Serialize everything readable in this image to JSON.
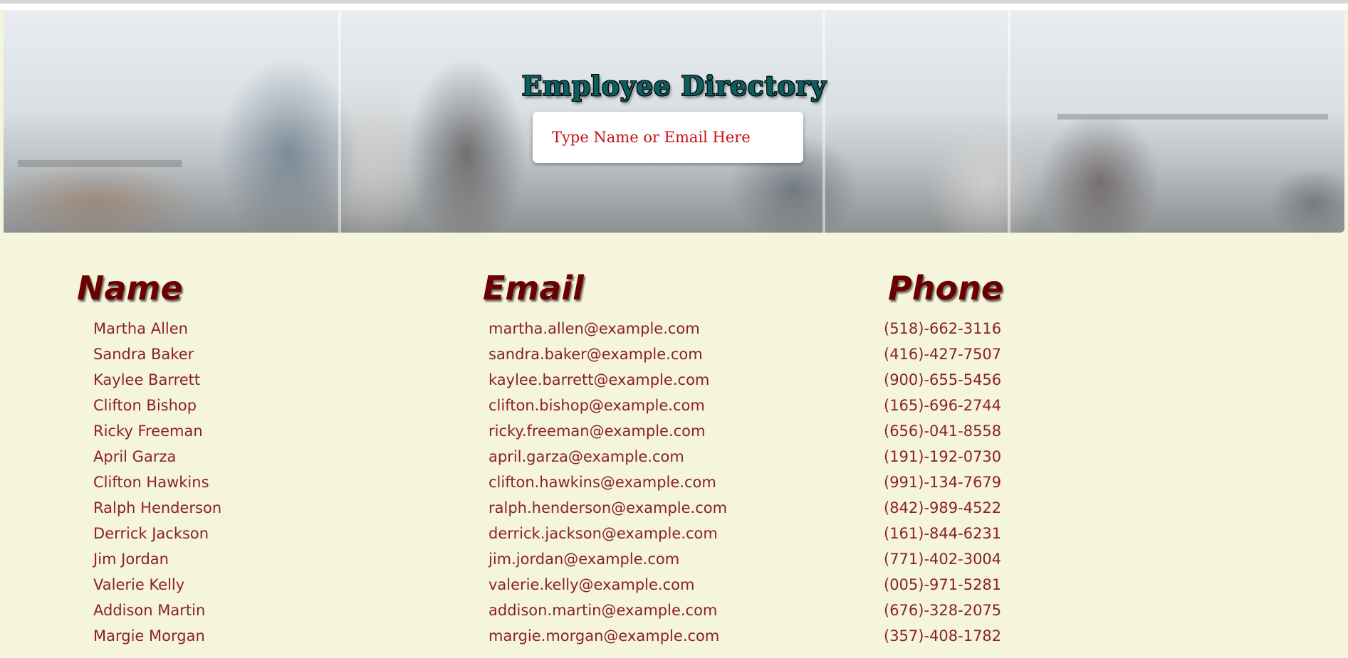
{
  "header": {
    "title": "Employee Directory",
    "search_placeholder": "Type Name or Email Here",
    "search_value": ""
  },
  "table": {
    "columns": [
      "Name",
      "Email",
      "Phone"
    ],
    "rows": [
      {
        "name": "Martha Allen",
        "email": "martha.allen@example.com",
        "phone": "(518)-662-3116"
      },
      {
        "name": "Sandra Baker",
        "email": "sandra.baker@example.com",
        "phone": "(416)-427-7507"
      },
      {
        "name": "Kaylee Barrett",
        "email": "kaylee.barrett@example.com",
        "phone": "(900)-655-5456"
      },
      {
        "name": "Clifton Bishop",
        "email": "clifton.bishop@example.com",
        "phone": "(165)-696-2744"
      },
      {
        "name": "Ricky Freeman",
        "email": "ricky.freeman@example.com",
        "phone": "(656)-041-8558"
      },
      {
        "name": "April Garza",
        "email": "april.garza@example.com",
        "phone": "(191)-192-0730"
      },
      {
        "name": "Clifton Hawkins",
        "email": "clifton.hawkins@example.com",
        "phone": "(991)-134-7679"
      },
      {
        "name": "Ralph Henderson",
        "email": "ralph.henderson@example.com",
        "phone": "(842)-989-4522"
      },
      {
        "name": "Derrick Jackson",
        "email": "derrick.jackson@example.com",
        "phone": "(161)-844-6231"
      },
      {
        "name": "Jim Jordan",
        "email": "jim.jordan@example.com",
        "phone": "(771)-402-3004"
      },
      {
        "name": "Valerie Kelly",
        "email": "valerie.kelly@example.com",
        "phone": "(005)-971-5281"
      },
      {
        "name": "Addison Martin",
        "email": "addison.martin@example.com",
        "phone": "(676)-328-2075"
      },
      {
        "name": "Margie Morgan",
        "email": "margie.morgan@example.com",
        "phone": "(357)-408-1782"
      }
    ]
  },
  "colors": {
    "page_background": "#f5f4dc",
    "header_text": "#6b0000",
    "row_text": "#8b2222",
    "title_color": "#0b5f60",
    "placeholder_color": "#c8101a"
  }
}
